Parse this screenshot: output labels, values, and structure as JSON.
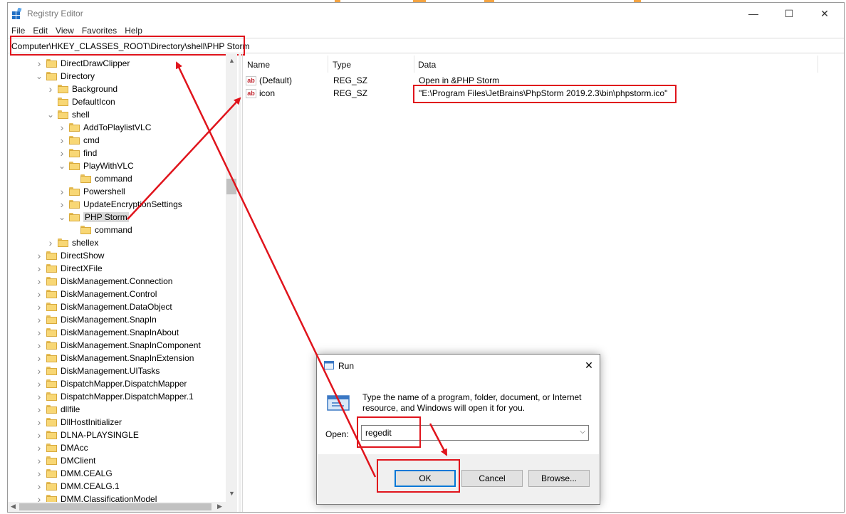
{
  "window": {
    "title": "Registry Editor"
  },
  "menu": [
    "File",
    "Edit",
    "View",
    "Favorites",
    "Help"
  ],
  "address": "Computer\\HKEY_CLASSES_ROOT\\Directory\\shell\\PHP Storm",
  "tree": [
    {
      "label": "DirectDrawClipper",
      "depth": 0,
      "toggle": "collapsed"
    },
    {
      "label": "Directory",
      "depth": 0,
      "toggle": "expanded"
    },
    {
      "label": "Background",
      "depth": 1,
      "toggle": "collapsed"
    },
    {
      "label": "DefaultIcon",
      "depth": 1,
      "toggle": "none"
    },
    {
      "label": "shell",
      "depth": 1,
      "toggle": "expanded"
    },
    {
      "label": "AddToPlaylistVLC",
      "depth": 2,
      "toggle": "collapsed"
    },
    {
      "label": "cmd",
      "depth": 2,
      "toggle": "collapsed"
    },
    {
      "label": "find",
      "depth": 2,
      "toggle": "collapsed"
    },
    {
      "label": "PlayWithVLC",
      "depth": 2,
      "toggle": "expanded"
    },
    {
      "label": "command",
      "depth": 3,
      "toggle": "none"
    },
    {
      "label": "Powershell",
      "depth": 2,
      "toggle": "collapsed"
    },
    {
      "label": "UpdateEncryptionSettings",
      "depth": 2,
      "toggle": "collapsed"
    },
    {
      "label": "PHP Storm",
      "depth": 2,
      "toggle": "expanded",
      "selected": true
    },
    {
      "label": "command",
      "depth": 3,
      "toggle": "none"
    },
    {
      "label": "shellex",
      "depth": 1,
      "toggle": "collapsed"
    },
    {
      "label": "DirectShow",
      "depth": 0,
      "toggle": "collapsed"
    },
    {
      "label": "DirectXFile",
      "depth": 0,
      "toggle": "collapsed"
    },
    {
      "label": "DiskManagement.Connection",
      "depth": 0,
      "toggle": "collapsed"
    },
    {
      "label": "DiskManagement.Control",
      "depth": 0,
      "toggle": "collapsed"
    },
    {
      "label": "DiskManagement.DataObject",
      "depth": 0,
      "toggle": "collapsed"
    },
    {
      "label": "DiskManagement.SnapIn",
      "depth": 0,
      "toggle": "collapsed"
    },
    {
      "label": "DiskManagement.SnapInAbout",
      "depth": 0,
      "toggle": "collapsed"
    },
    {
      "label": "DiskManagement.SnapInComponent",
      "depth": 0,
      "toggle": "collapsed"
    },
    {
      "label": "DiskManagement.SnapInExtension",
      "depth": 0,
      "toggle": "collapsed"
    },
    {
      "label": "DiskManagement.UITasks",
      "depth": 0,
      "toggle": "collapsed"
    },
    {
      "label": "DispatchMapper.DispatchMapper",
      "depth": 0,
      "toggle": "collapsed"
    },
    {
      "label": "DispatchMapper.DispatchMapper.1",
      "depth": 0,
      "toggle": "collapsed"
    },
    {
      "label": "dllfile",
      "depth": 0,
      "toggle": "collapsed"
    },
    {
      "label": "DllHostInitializer",
      "depth": 0,
      "toggle": "collapsed"
    },
    {
      "label": "DLNA-PLAYSINGLE",
      "depth": 0,
      "toggle": "collapsed"
    },
    {
      "label": "DMAcc",
      "depth": 0,
      "toggle": "collapsed"
    },
    {
      "label": "DMClient",
      "depth": 0,
      "toggle": "collapsed"
    },
    {
      "label": "DMM.CEALG",
      "depth": 0,
      "toggle": "collapsed"
    },
    {
      "label": "DMM.CEALG.1",
      "depth": 0,
      "toggle": "collapsed"
    },
    {
      "label": "DMM.ClassificationModel",
      "depth": 0,
      "toggle": "collapsed"
    }
  ],
  "columns": {
    "name": "Name",
    "type": "Type",
    "data": "Data"
  },
  "values": [
    {
      "name": "(Default)",
      "type": "REG_SZ",
      "data": "Open in &PHP Storm",
      "icon": "string-value-icon"
    },
    {
      "name": "icon",
      "type": "REG_SZ",
      "data": "\"E:\\Program Files\\JetBrains\\PhpStorm 2019.2.3\\bin\\phpstorm.ico\"",
      "icon": "string-value-icon"
    }
  ],
  "run": {
    "title": "Run",
    "message": "Type the name of a program, folder, document, or Internet resource, and Windows will open it for you.",
    "open_label": "Open:",
    "open_value": "regedit",
    "ok": "OK",
    "cancel": "Cancel",
    "browse": "Browse..."
  },
  "colors": {
    "highlight": "#e0141c",
    "selection": "#d9d9d9",
    "folder": "#f8d775",
    "accent": "#0078d7"
  }
}
